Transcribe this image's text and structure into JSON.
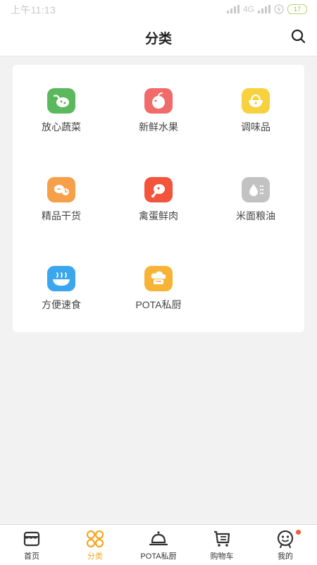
{
  "status_bar": {
    "time": "上午11:13",
    "network": "4G",
    "battery": "17"
  },
  "header": {
    "title": "分类",
    "search_icon": "search-icon"
  },
  "categories": [
    {
      "label": "放心蔬菜",
      "icon": "vegetable-icon",
      "color": "#5cb85c"
    },
    {
      "label": "新鲜水果",
      "icon": "fruit-icon",
      "color": "#f26b6b"
    },
    {
      "label": "调味品",
      "icon": "condiment-icon",
      "color": "#f7d23e"
    },
    {
      "label": "精品干货",
      "icon": "dried-goods-icon",
      "color": "#f7a04a"
    },
    {
      "label": "禽蛋鲜肉",
      "icon": "meat-icon",
      "color": "#f2553c"
    },
    {
      "label": "米面粮油",
      "icon": "grain-oil-icon",
      "color": "#c2c2c2"
    },
    {
      "label": "方便速食",
      "icon": "instant-food-icon",
      "color": "#3aa6ee"
    },
    {
      "label": "POTA私厨",
      "icon": "chef-icon",
      "color": "#f7b336"
    }
  ],
  "tabbar": {
    "active_color": "#f5a623",
    "items": [
      {
        "label": "首页",
        "icon": "store-icon"
      },
      {
        "label": "分类",
        "icon": "grid-icon",
        "active": true
      },
      {
        "label": "POTA私厨",
        "icon": "cloche-icon"
      },
      {
        "label": "购物车",
        "icon": "cart-icon"
      },
      {
        "label": "我的",
        "icon": "profile-icon",
        "badge": true
      }
    ]
  }
}
